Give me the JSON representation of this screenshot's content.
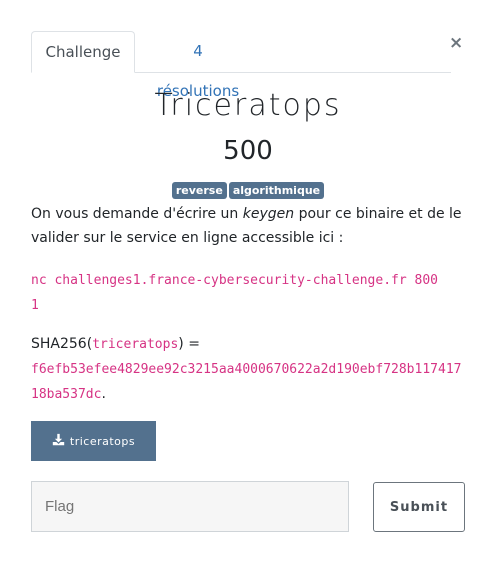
{
  "modal": {
    "close_label": "×"
  },
  "tabs": [
    {
      "label": "Challenge",
      "active": true
    },
    {
      "label": "4 résolutions",
      "active": false
    }
  ],
  "challenge": {
    "name": "Triceratops",
    "points": "500",
    "tags": [
      "reverse",
      "algorithmique"
    ],
    "description": {
      "part1": "On vous demande d'écrire un ",
      "emphasis": "keygen",
      "part2": " pour ce binaire et de le valider sur le service en ligne accessible ici :"
    },
    "command": "nc challenges1.france-cybersecurity-challenge.fr 8001",
    "sha": {
      "prefix": "SHA256(",
      "filename": "triceratops",
      "middle": ") =",
      "hash": "f6efb53efee4829ee92c3215aa4000670622a2d190ebf728b11741718ba537dc",
      "suffix": "."
    }
  },
  "download": {
    "icon": "download-icon",
    "label": "triceratops"
  },
  "flag_form": {
    "placeholder": "Flag",
    "value": "",
    "submit_label": "Submit"
  },
  "colors": {
    "accent": "#53718e",
    "link": "#3273b6",
    "code": "#d63384"
  }
}
